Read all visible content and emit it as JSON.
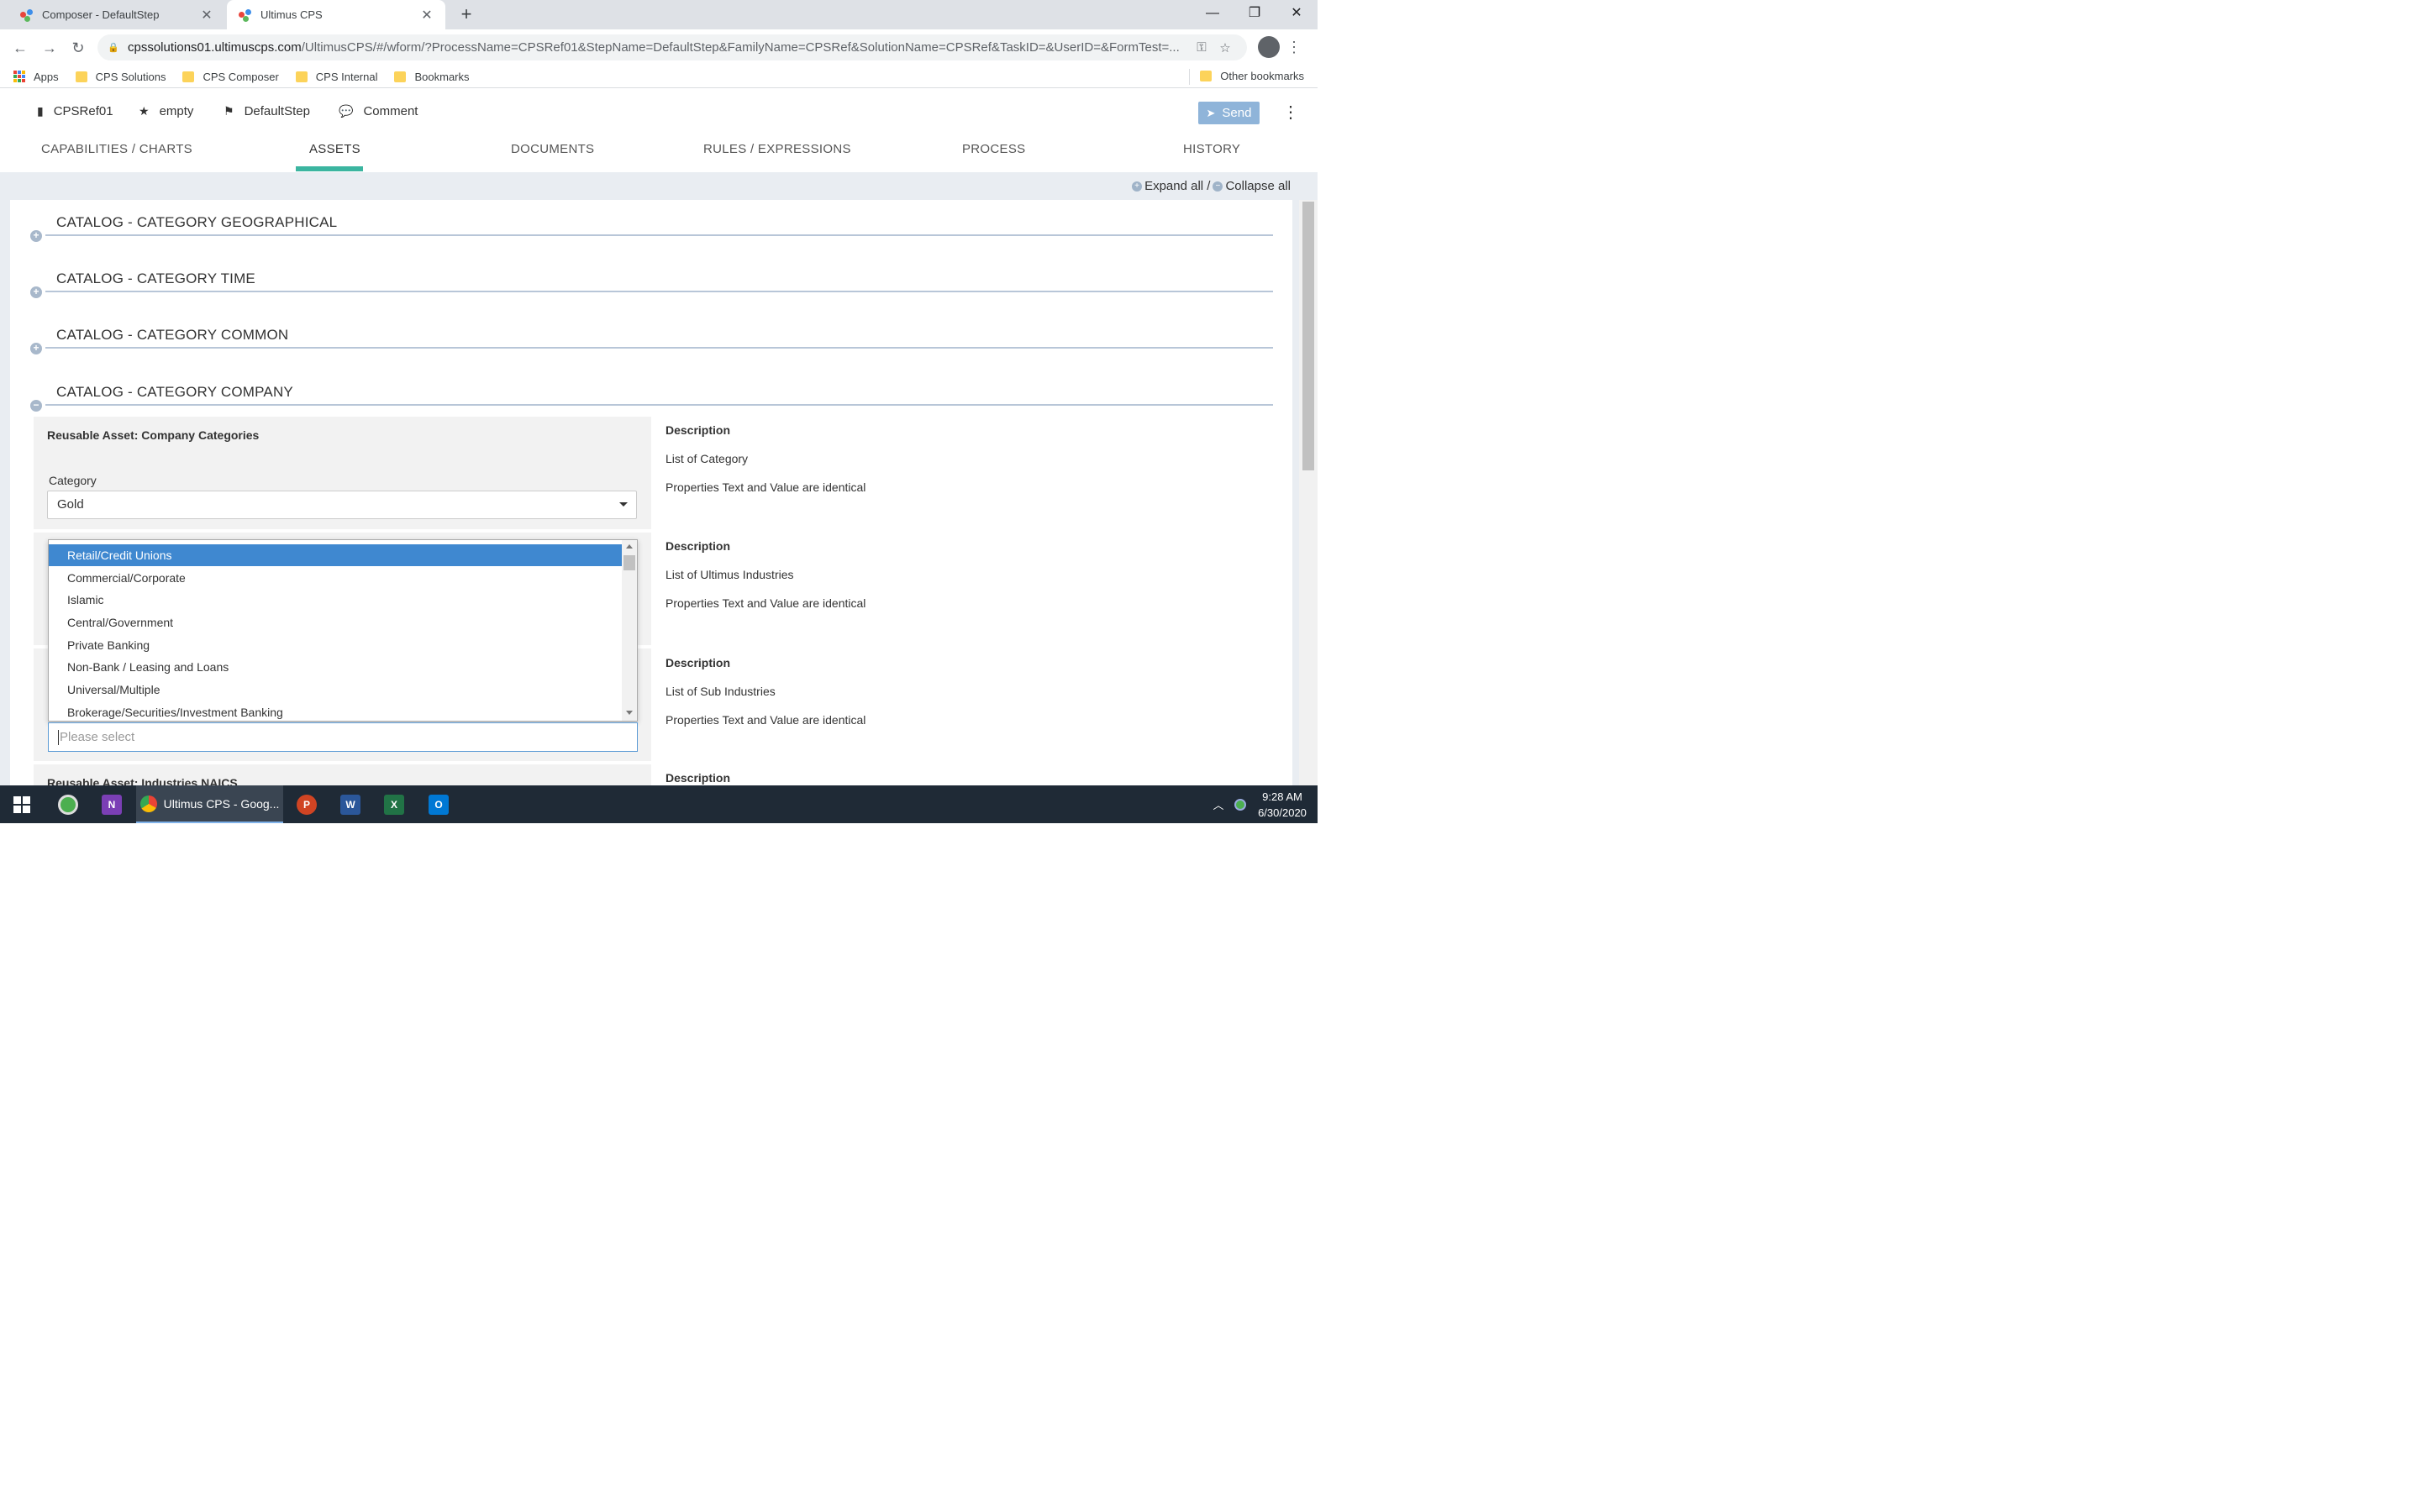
{
  "browser": {
    "tabs": [
      {
        "title": "Composer - DefaultStep",
        "active": false
      },
      {
        "title": "Ultimus CPS",
        "active": true
      }
    ],
    "url_host": "cpssolutions01.ultimuscps.com",
    "url_path": "/UltimusCPS/#/wform/?ProcessName=CPSRef01&StepName=DefaultStep&FamilyName=CPSRef&SolutionName=CPSRef&TaskID=&UserID=&FormTest=...",
    "bookmarks": [
      "Apps",
      "CPS Solutions",
      "CPS Composer",
      "CPS Internal",
      "Bookmarks"
    ],
    "other_bookmarks": "Other bookmarks"
  },
  "appbar": {
    "process": "CPSRef01",
    "favorite": "empty",
    "step": "DefaultStep",
    "comment": "Comment",
    "send": "Send"
  },
  "tabs": [
    {
      "label": "CAPABILITIES / CHARTS"
    },
    {
      "label": "ASSETS",
      "active": true
    },
    {
      "label": "DOCUMENTS"
    },
    {
      "label": "RULES / EXPRESSIONS"
    },
    {
      "label": "PROCESS"
    },
    {
      "label": "HISTORY"
    }
  ],
  "expand": {
    "expand_all": "Expand all /",
    "collapse_all": "Collapse all"
  },
  "sections": [
    {
      "title": "CATALOG - CATEGORY GEOGRAPHICAL",
      "expanded": false
    },
    {
      "title": "CATALOG - CATEGORY TIME",
      "expanded": false
    },
    {
      "title": "CATALOG - CATEGORY COMMON",
      "expanded": false
    },
    {
      "title": "CATALOG - CATEGORY COMPANY",
      "expanded": true
    }
  ],
  "company": {
    "asset1": {
      "title": "Reusable Asset: Company Categories",
      "field_label": "Category",
      "value": "Gold",
      "desc_title": "Description",
      "desc_line1": "List of Category",
      "desc_line2": "Properties Text and Value are identical"
    },
    "asset2": {
      "desc_title": "Description",
      "desc_line1": "List of Ultimus Industries",
      "desc_line2": "Properties Text and Value are identical"
    },
    "asset3": {
      "desc_title": "Description",
      "desc_line1": "List of Sub Industries",
      "desc_line2": "Properties Text and Value are identical"
    },
    "asset4": {
      "title": "Reusable Asset: Industries NAICS",
      "desc_title": "Description"
    }
  },
  "dropdown": {
    "options": [
      "Retail/Credit Unions",
      "Commercial/Corporate",
      "Islamic",
      "Central/Government",
      "Private Banking",
      "Non-Bank / Leasing and Loans",
      "Universal/Multiple",
      "Brokerage/Securities/Investment Banking"
    ],
    "highlighted": "Retail/Credit Unions",
    "placeholder": "Please select"
  },
  "taskbar": {
    "active_window": "Ultimus CPS - Goog...",
    "time": "9:28 AM",
    "date": "6/30/2020"
  }
}
